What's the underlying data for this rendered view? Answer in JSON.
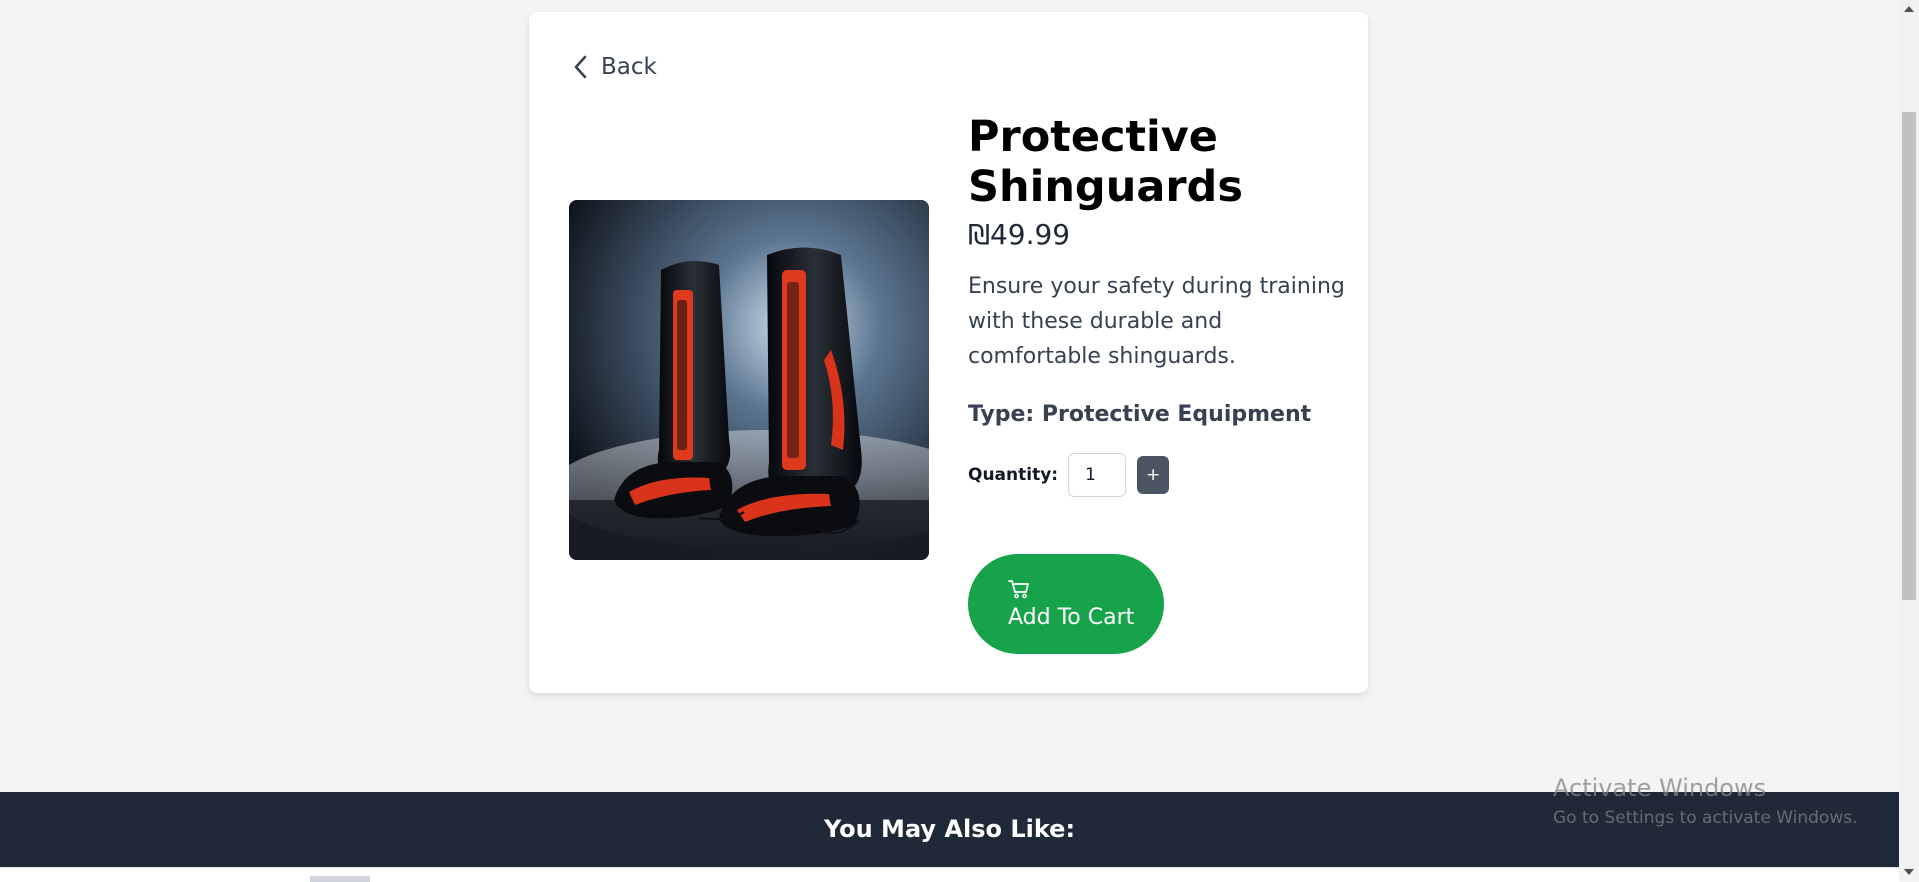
{
  "nav": {
    "back_label": "Back"
  },
  "product": {
    "title": "Protective Shinguards",
    "price": "₪49.99",
    "description": "Ensure your safety during training with these durable and comfortable shinguards.",
    "type_label": "Type: Protective Equipment",
    "image_alt": "Protective Shinguards"
  },
  "quantity": {
    "label": "Quantity:",
    "value": "1",
    "plus_label": "+"
  },
  "cart": {
    "button_label": "Add To Cart",
    "icon": "shopping-cart-icon"
  },
  "recommendations": {
    "heading": "You May Also Like:"
  },
  "watermark": {
    "title": "Activate Windows",
    "subtitle": "Go to Settings to activate Windows."
  },
  "colors": {
    "page_bg": "#f3f4f6",
    "card_bg": "#ffffff",
    "cart_button": "#16a34a",
    "plus_button": "#4b5563",
    "footer_bg": "#1f2937"
  }
}
